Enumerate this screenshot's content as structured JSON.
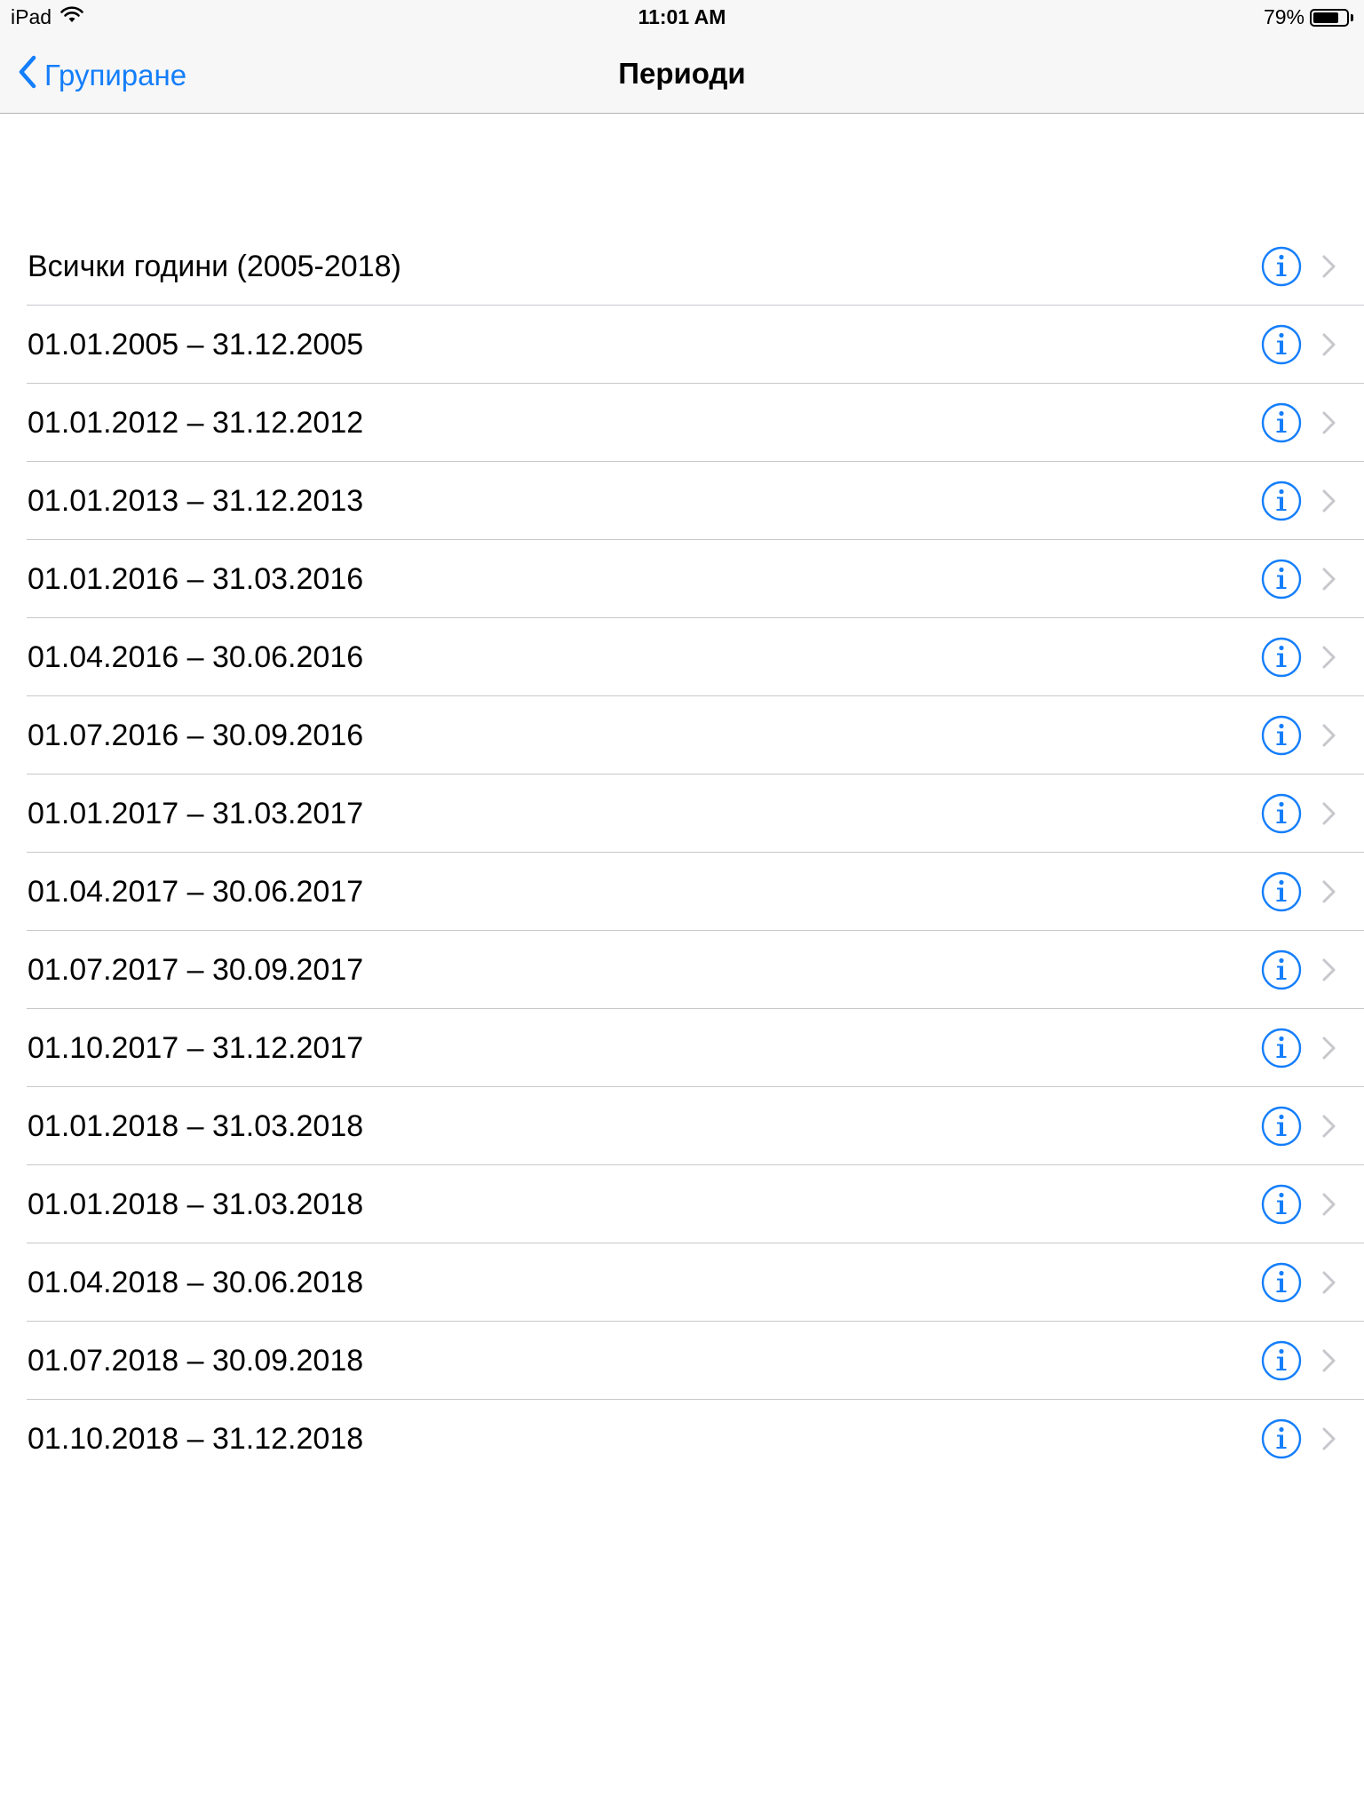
{
  "status_bar": {
    "device": "iPad",
    "time": "11:01 AM",
    "battery_percent": "79%",
    "battery_level": 0.79,
    "icons": [
      "wifi-icon",
      "battery-icon"
    ]
  },
  "nav": {
    "back_label": "Групиране",
    "title": "Периоди"
  },
  "colors": {
    "accent": "#147efb",
    "bar_background": "#f7f7f7",
    "separator": "#c8c7cc",
    "chevron": "#c7c7cc"
  },
  "periods": [
    {
      "label": "Всички години (2005-2018)"
    },
    {
      "label": "01.01.2005 – 31.12.2005"
    },
    {
      "label": "01.01.2012 – 31.12.2012"
    },
    {
      "label": "01.01.2013 – 31.12.2013"
    },
    {
      "label": "01.01.2016 – 31.03.2016"
    },
    {
      "label": "01.04.2016 – 30.06.2016"
    },
    {
      "label": "01.07.2016 – 30.09.2016"
    },
    {
      "label": "01.01.2017 – 31.03.2017"
    },
    {
      "label": "01.04.2017 – 30.06.2017"
    },
    {
      "label": "01.07.2017 – 30.09.2017"
    },
    {
      "label": "01.10.2017 – 31.12.2017"
    },
    {
      "label": "01.01.2018 – 31.03.2018"
    },
    {
      "label": "01.01.2018 – 31.03.2018"
    },
    {
      "label": "01.04.2018 – 30.06.2018"
    },
    {
      "label": "01.07.2018 – 30.09.2018"
    },
    {
      "label": "01.10.2018 – 31.12.2018"
    }
  ]
}
